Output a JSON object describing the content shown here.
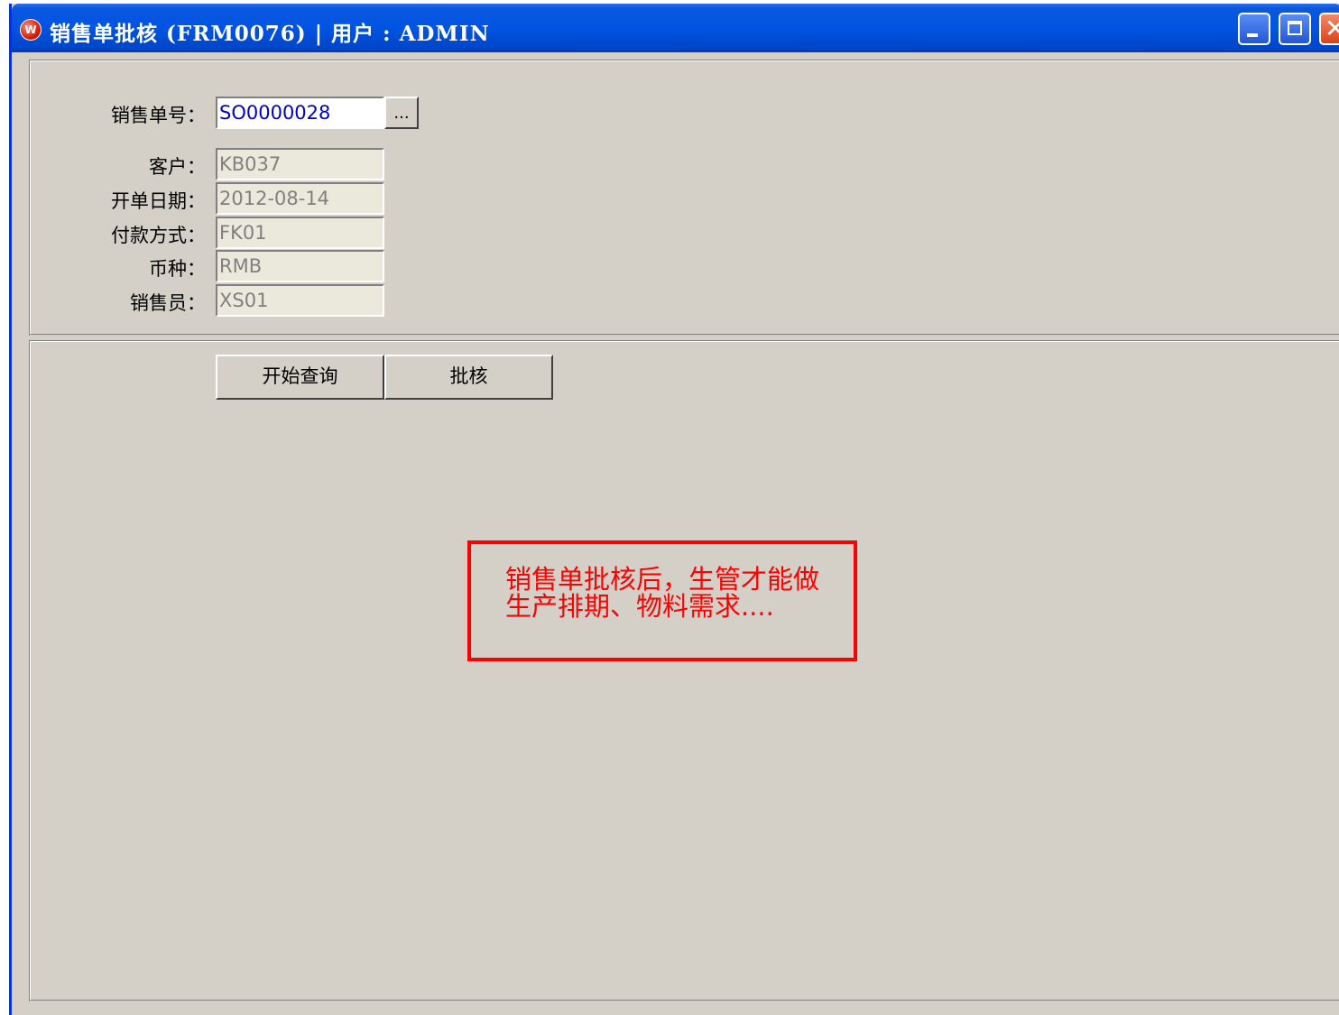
{
  "window": {
    "title": "销售单批核 (FRM0076) | 用户 : ADMIN",
    "app_icon": "app-logo-icon",
    "controls": [
      "minimize-icon",
      "maximize-icon",
      "close-icon"
    ]
  },
  "form": {
    "order_no": {
      "label": "销售单号：",
      "value": "SO0000028",
      "browse_label": "..."
    },
    "customer": {
      "label": "客户：",
      "value": "KB037"
    },
    "order_date": {
      "label": "开单日期：",
      "value": "2012-08-14"
    },
    "payment_method": {
      "label": "付款方式：",
      "value": "FK01"
    },
    "currency": {
      "label": "币种：",
      "value": "RMB"
    },
    "salesperson": {
      "label": "销售员：",
      "value": "XS01"
    }
  },
  "actions": {
    "query_label": "开始查询",
    "approve_label": "批核"
  },
  "annotation": {
    "text": "销售单批核后，生管才能做生产排期、物料需求....",
    "color": "#ff0000"
  }
}
